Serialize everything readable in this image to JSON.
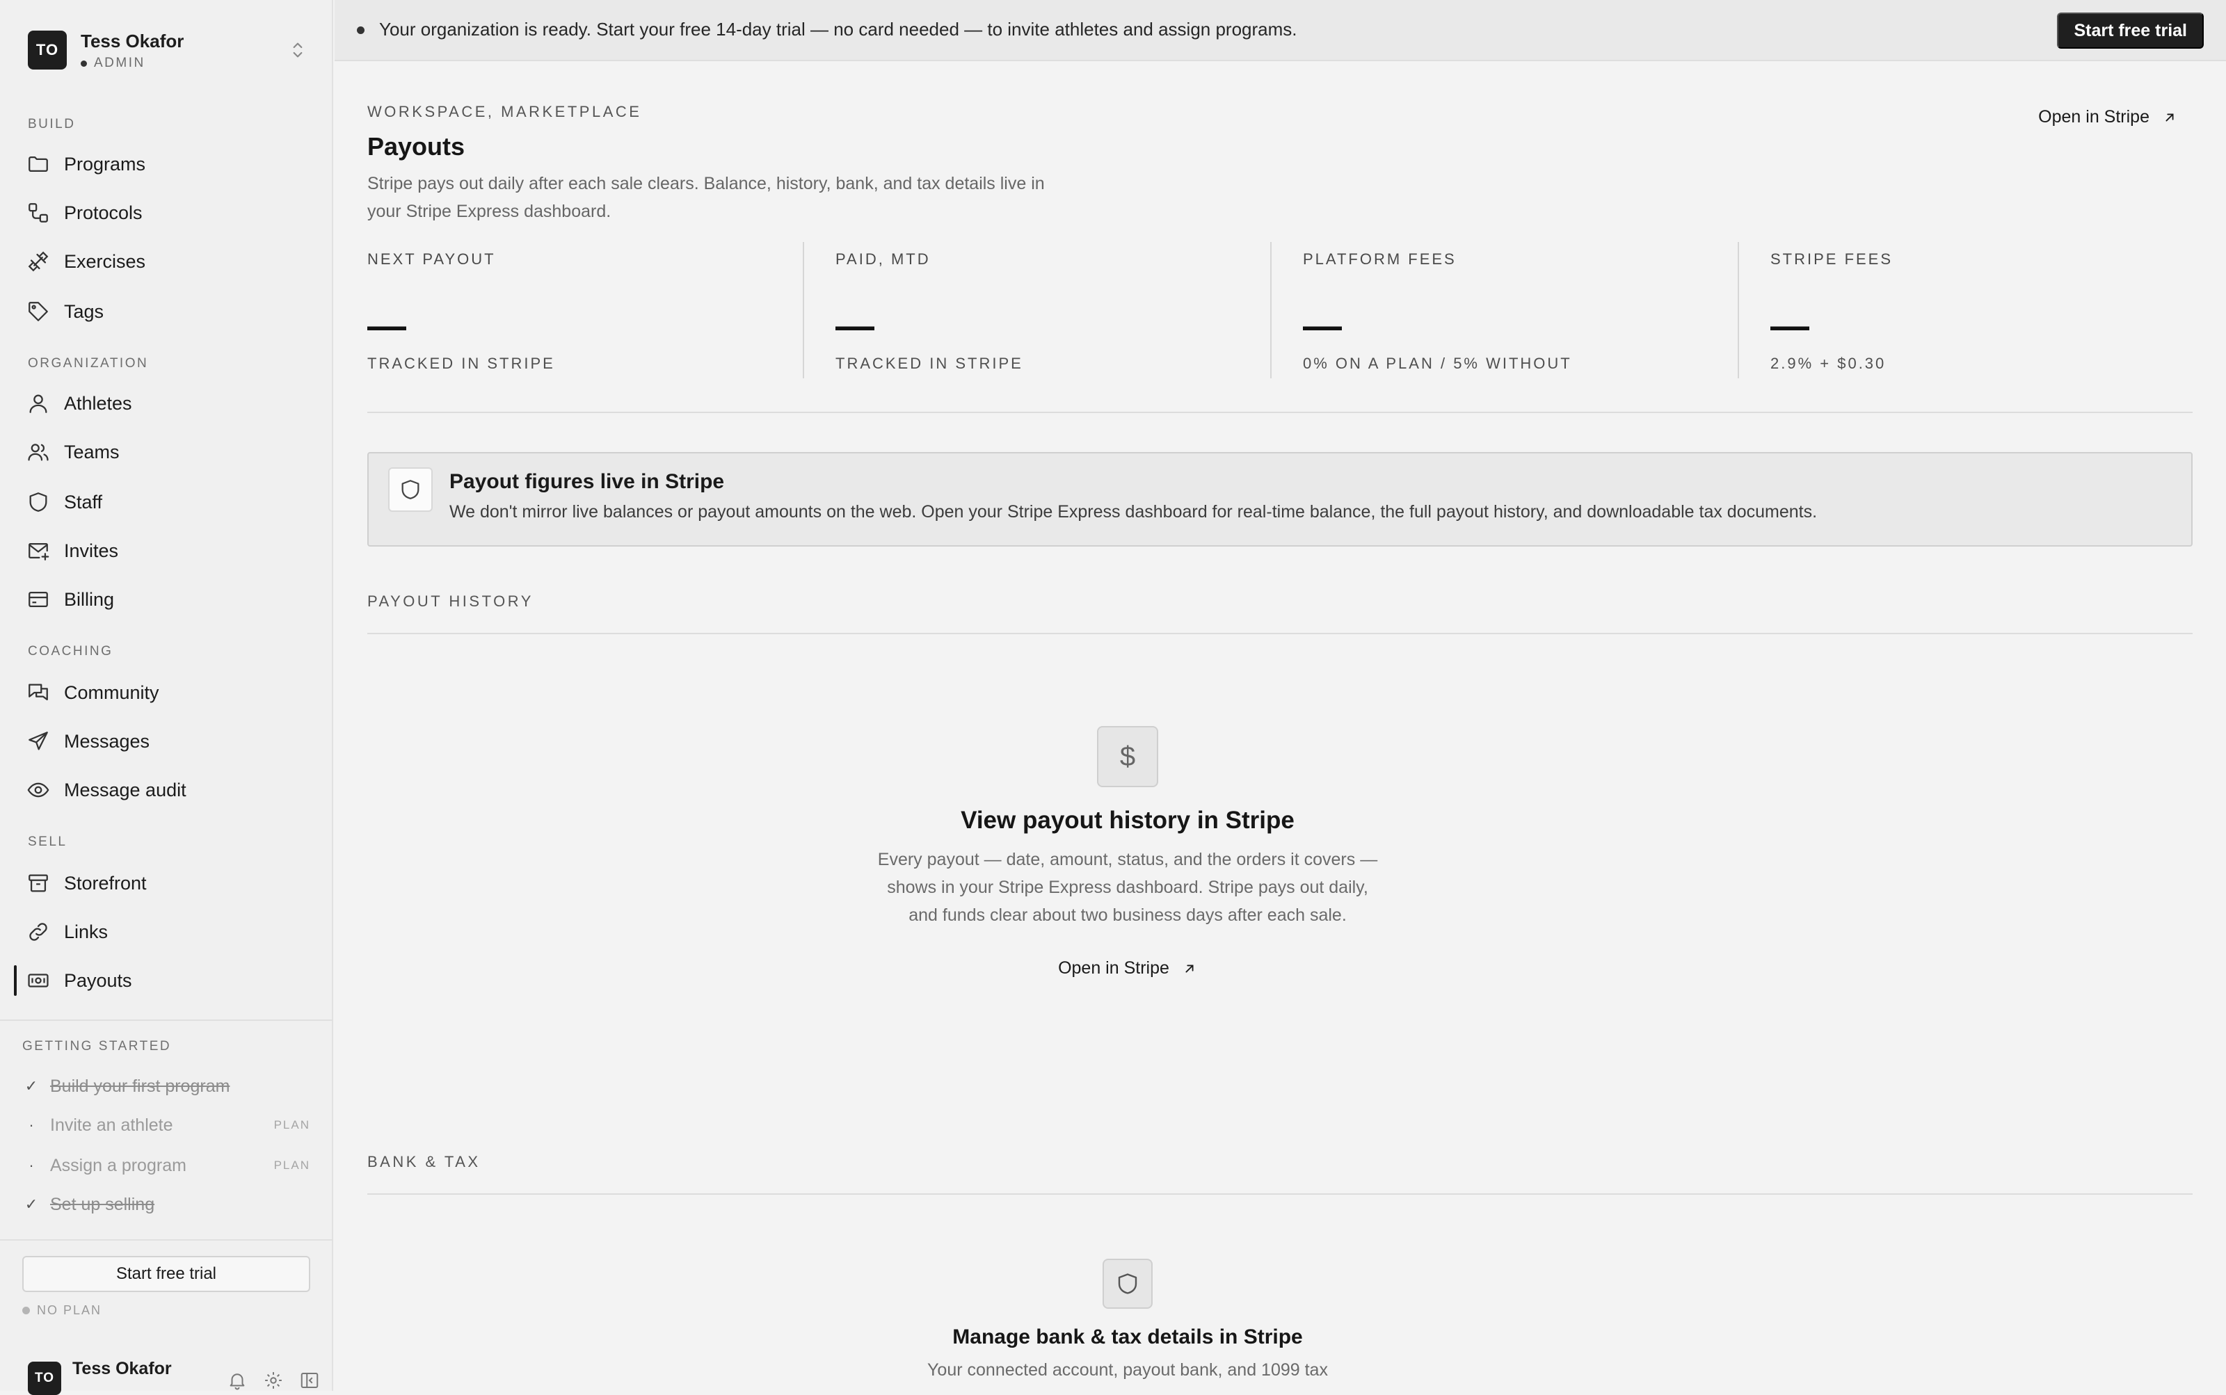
{
  "org": {
    "initials": "TO",
    "name": "Tess Okafor",
    "role": "ADMIN"
  },
  "sidebar": {
    "sections": [
      {
        "title": "BUILD",
        "items": [
          {
            "label": "Programs",
            "icon": "folder-icon"
          },
          {
            "label": "Protocols",
            "icon": "protocols-icon"
          },
          {
            "label": "Exercises",
            "icon": "dumbbell-icon"
          },
          {
            "label": "Tags",
            "icon": "tag-icon"
          }
        ]
      },
      {
        "title": "ORGANIZATION",
        "items": [
          {
            "label": "Athletes",
            "icon": "user-icon"
          },
          {
            "label": "Teams",
            "icon": "users-icon"
          },
          {
            "label": "Staff",
            "icon": "shield-icon"
          },
          {
            "label": "Invites",
            "icon": "mail-plus-icon"
          },
          {
            "label": "Billing",
            "icon": "credit-card-icon"
          }
        ]
      },
      {
        "title": "COACHING",
        "items": [
          {
            "label": "Community",
            "icon": "chat-icon"
          },
          {
            "label": "Messages",
            "icon": "send-icon"
          },
          {
            "label": "Message audit",
            "icon": "eye-icon"
          }
        ]
      },
      {
        "title": "SELL",
        "items": [
          {
            "label": "Storefront",
            "icon": "archive-icon"
          },
          {
            "label": "Links",
            "icon": "link-icon"
          },
          {
            "label": "Payouts",
            "icon": "banknote-icon",
            "active": true
          }
        ]
      }
    ],
    "getting_started": {
      "title": "GETTING STARTED",
      "items": [
        {
          "label": "Build your first program",
          "done": true,
          "tag": ""
        },
        {
          "label": "Invite an athlete",
          "done": false,
          "tag": "PLAN"
        },
        {
          "label": "Assign a program",
          "done": false,
          "tag": "PLAN"
        },
        {
          "label": "Set up selling",
          "done": true,
          "tag": ""
        }
      ]
    },
    "trial_button": "Start free trial",
    "plan_status": "NO PLAN",
    "footer": {
      "initials": "TO",
      "name": "Tess Okafor"
    }
  },
  "banner": {
    "text": "Your organization is ready. Start your free 14-day trial — no card needed — to invite athletes and assign programs.",
    "button": "Start free trial"
  },
  "main": {
    "eyebrow": "WORKSPACE, MARKETPLACE",
    "title": "Payouts",
    "description": "Stripe pays out daily after each sale clears. Balance, history, bank, and tax details live in your Stripe Express dashboard.",
    "open_stripe": "Open in Stripe",
    "stats": [
      {
        "label": "NEXT PAYOUT",
        "value": "—",
        "sub": "TRACKED IN STRIPE"
      },
      {
        "label": "PAID, MTD",
        "value": "—",
        "sub": "TRACKED IN STRIPE"
      },
      {
        "label": "PLATFORM FEES",
        "value": "—",
        "sub": "0% ON A PLAN / 5% WITHOUT"
      },
      {
        "label": "STRIPE FEES",
        "value": "—",
        "sub": "2.9% + $0.30"
      }
    ],
    "callout": {
      "title": "Payout figures live in Stripe",
      "body": "We don't mirror live balances or payout amounts on the web. Open your Stripe Express dashboard for real-time balance, the full payout history, and downloadable tax documents."
    },
    "payout_history": {
      "label": "PAYOUT HISTORY",
      "icon_glyph": "$",
      "title": "View payout history in Stripe",
      "body": "Every payout — date, amount, status, and the orders it covers — shows in your Stripe Express dashboard. Stripe pays out daily, and funds clear about two business days after each sale.",
      "link": "Open in Stripe"
    },
    "bank_tax": {
      "label": "BANK & TAX",
      "title": "Manage bank & tax details in Stripe",
      "body": "Your connected account, payout bank, and 1099 tax"
    }
  }
}
